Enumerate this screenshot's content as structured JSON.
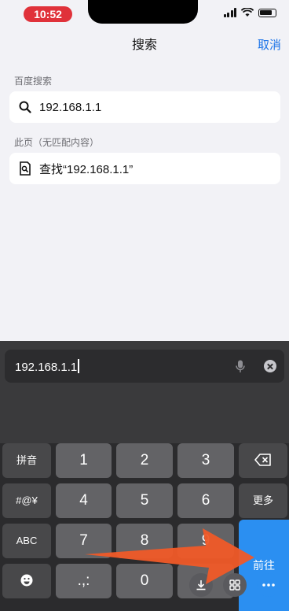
{
  "status": {
    "time": "10:52"
  },
  "nav": {
    "title": "搜索",
    "cancel": "取消"
  },
  "sections": [
    {
      "label": "百度搜索",
      "item": "192.168.1.1"
    },
    {
      "label": "此页（无匹配内容）",
      "item": "查找“192.168.1.1”"
    }
  ],
  "input": {
    "value": "192.168.1.1"
  },
  "keyboard": {
    "left_col": [
      "拼音",
      "#@¥",
      "ABC"
    ],
    "rows": [
      [
        "1",
        "2",
        "3"
      ],
      [
        "4",
        "5",
        "6"
      ],
      [
        "7",
        "8",
        "9"
      ]
    ],
    "bottom": [
      ".,:",
      "0"
    ],
    "right_col": {
      "more": "更多",
      "go": "前往"
    }
  },
  "colors": {
    "accent": "#1a73e8",
    "go_key": "#2b8ff1",
    "annotation_arrow": "#f05a28"
  }
}
